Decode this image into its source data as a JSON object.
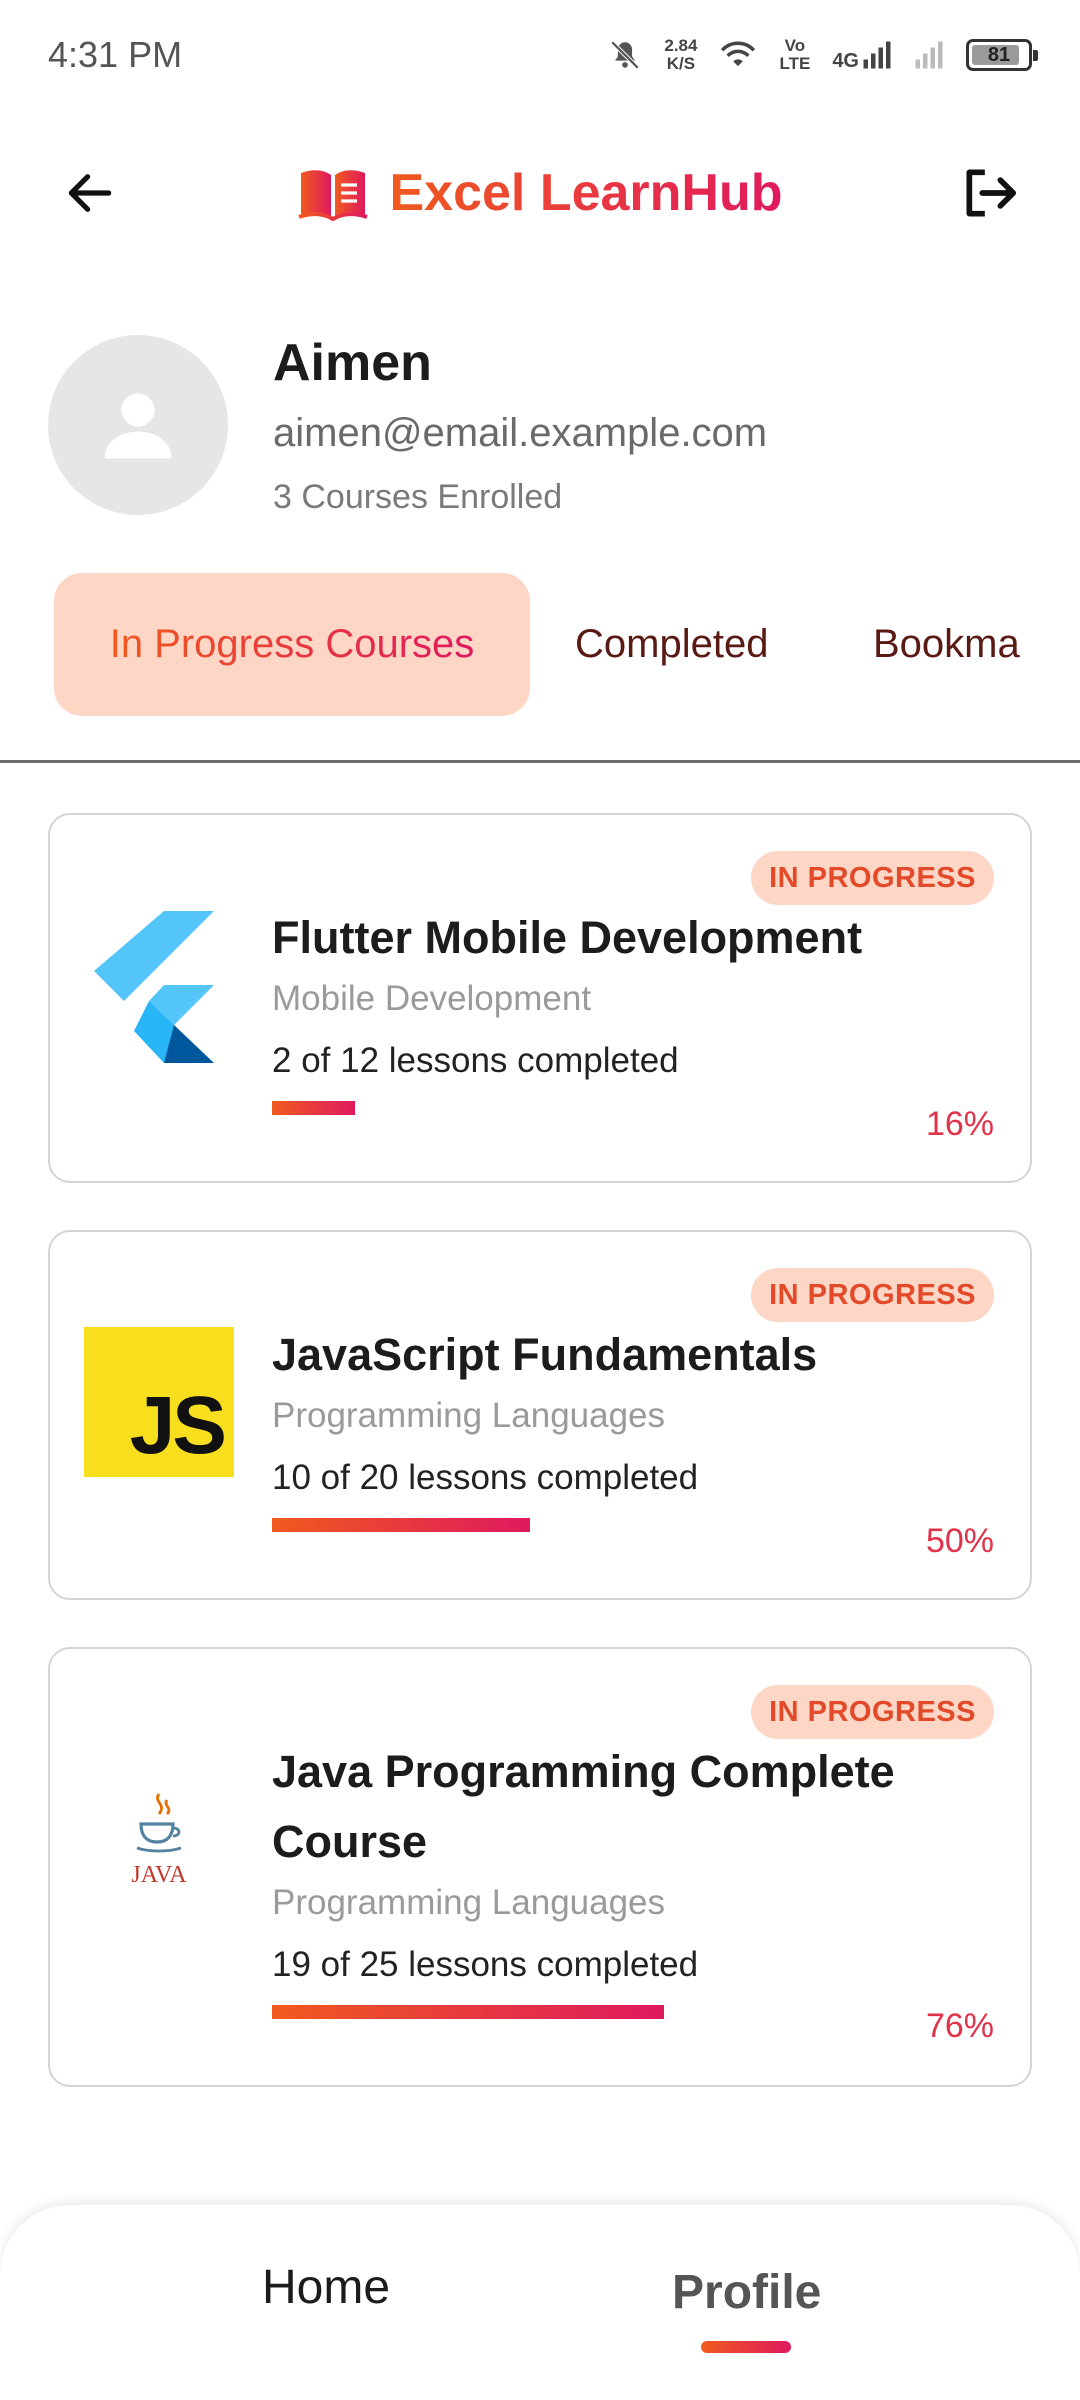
{
  "status_bar": {
    "time": "4:31 PM",
    "net_speed_top": "2.84",
    "net_speed_bottom": "K/S",
    "volte_top": "Vo",
    "volte_bottom": "LTE",
    "network": "4G",
    "battery": "81"
  },
  "header": {
    "brand": "Excel LearnHub",
    "icons": [
      "arrow-left-icon",
      "book-icon",
      "logout-icon"
    ],
    "colors": {
      "brand_start": "#f05a1e",
      "brand_end": "#e0195f"
    }
  },
  "profile": {
    "name": "Aimen",
    "email": "aimen@email.example.com",
    "enrolled": "3 Courses Enrolled"
  },
  "tabs": [
    {
      "label": "In Progress Courses",
      "active": true
    },
    {
      "label": "Completed",
      "active": false
    },
    {
      "label": "Bookma",
      "active": false
    }
  ],
  "courses": [
    {
      "badge": "IN PROGRESS",
      "title": "Flutter Mobile Development",
      "category": "Mobile Development",
      "lessons": "2 of 12 lessons completed",
      "percent_label": "16%",
      "progress": 0.16,
      "logo": "flutter-logo"
    },
    {
      "badge": "IN PROGRESS",
      "title": "JavaScript Fundamentals",
      "category": "Programming Languages",
      "lessons": "10 of 20 lessons completed",
      "percent_label": "50%",
      "progress": 0.5,
      "logo": "javascript-logo",
      "logo_text": "JS"
    },
    {
      "badge": "IN PROGRESS",
      "title": "Java Programming Complete Course",
      "category": "Programming Languages",
      "lessons": "19 of 25 lessons completed",
      "percent_label": "76%",
      "progress": 0.76,
      "logo": "java-logo",
      "logo_text": "JAVA"
    }
  ],
  "bottom_nav": {
    "home": "Home",
    "profile": "Profile",
    "active": "Profile"
  }
}
